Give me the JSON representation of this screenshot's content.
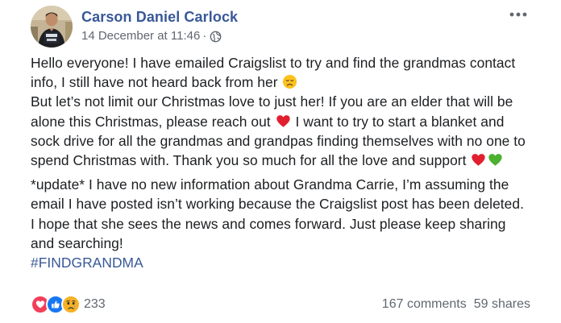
{
  "post": {
    "author_name": "Carson Daniel Carlock",
    "timestamp": "14 December at 11:46",
    "separator": "·",
    "audience_icon": "globe-icon",
    "more_icon": "more-options-icon",
    "avatar": "profile-photo",
    "body": {
      "p1_line1": "Hello everyone! I have emailed Craigslist to try and find the grandmas contact info, I still have not heard back from her",
      "p1_emoji1": "disappointed-face-emoji",
      "p1_line2_a": "But let’s not limit our Christmas love to just her! If you are an elder that will be alone this Christmas, please reach out",
      "p1_emoji2": "red-heart-emoji",
      "p1_line2_b": "I want to try to start a blanket and sock drive for all the grandmas and grandpas finding themselves with no one to spend Christmas with. Thank you so much for all the love and support",
      "p1_emoji3": "red-heart-emoji",
      "p1_emoji4": "green-heart-emoji",
      "p2": "*update* I have no new information about Grandma Carrie, I’m assuming the email I have posted isn’t working because the Craigslist post has been deleted. I hope that she sees the news and comes forward. Just please keep sharing and searching!",
      "hashtag": "#FINDGRANDMA"
    }
  },
  "footer": {
    "reaction_icons": [
      "love-reaction-icon",
      "like-reaction-icon",
      "sad-reaction-icon"
    ],
    "reaction_count": "233",
    "comments": "167 comments",
    "shares": "59 shares"
  },
  "colors": {
    "link_blue": "#385898",
    "text": "#1c1e21",
    "meta_gray": "#616770",
    "like_blue": "#1877f2",
    "love_red": "#f33e58",
    "sad_yellow": "#f7b125"
  }
}
